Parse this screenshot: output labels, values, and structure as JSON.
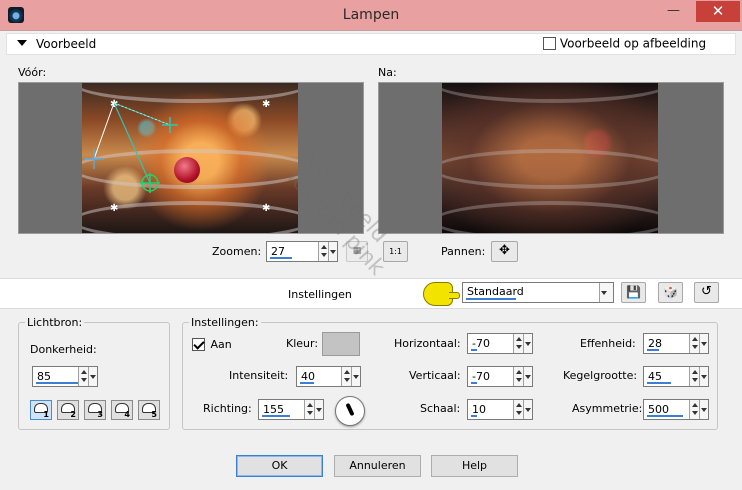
{
  "window": {
    "title": "Lampen",
    "minimize_glyph": "—",
    "close_glyph": "✕"
  },
  "header": {
    "section_title": "Voorbeeld",
    "preview_on_image_label": "Voorbeeld op afbeelding",
    "preview_on_image_checked": false
  },
  "preview": {
    "before_label": "Vóór:",
    "after_label": "Na:",
    "watermark_lines": [
      "voorbeeld",
      "les van pink"
    ]
  },
  "zoom": {
    "label": "Zoomen:",
    "value": "27",
    "fit_button_glyph": "1:1",
    "pan_label": "Pannen:",
    "pan_glyph": "✥"
  },
  "presets": {
    "label": "Instellingen",
    "selected": "Standaard",
    "save_glyph": "💾",
    "random_glyph": "🎲",
    "reset_glyph": "↺"
  },
  "lightsource": {
    "group_title": "Lichtbron:",
    "darkness_label": "Donkerheid:",
    "darkness_value": "85",
    "buttons": [
      "1",
      "2",
      "3",
      "4",
      "5"
    ],
    "active_button": "1"
  },
  "settings": {
    "group_title": "Instellingen:",
    "on_label": "Aan",
    "on_checked": true,
    "color_label": "Kleur:",
    "color_value": "#c3c3c3",
    "intensity_label": "Intensiteit:",
    "intensity_value": "40",
    "direction_label": "Richting:",
    "direction_value": "155",
    "horizontal_label": "Horizontaal:",
    "horizontal_value": "-70",
    "vertical_label": "Verticaal:",
    "vertical_value": "-70",
    "scale_label": "Schaal:",
    "scale_value": "10",
    "smoothness_label": "Effenheid:",
    "smoothness_value": "28",
    "cone_label": "Kegelgrootte:",
    "cone_value": "45",
    "asymmetry_label": "Asymmetrie:",
    "asymmetry_value": "500"
  },
  "buttons": {
    "ok": "OK",
    "cancel": "Annuleren",
    "help": "Help"
  },
  "colors": {
    "titlebar": "#e8a0a0",
    "close": "#c7413a",
    "accent": "#3a7fd4"
  }
}
